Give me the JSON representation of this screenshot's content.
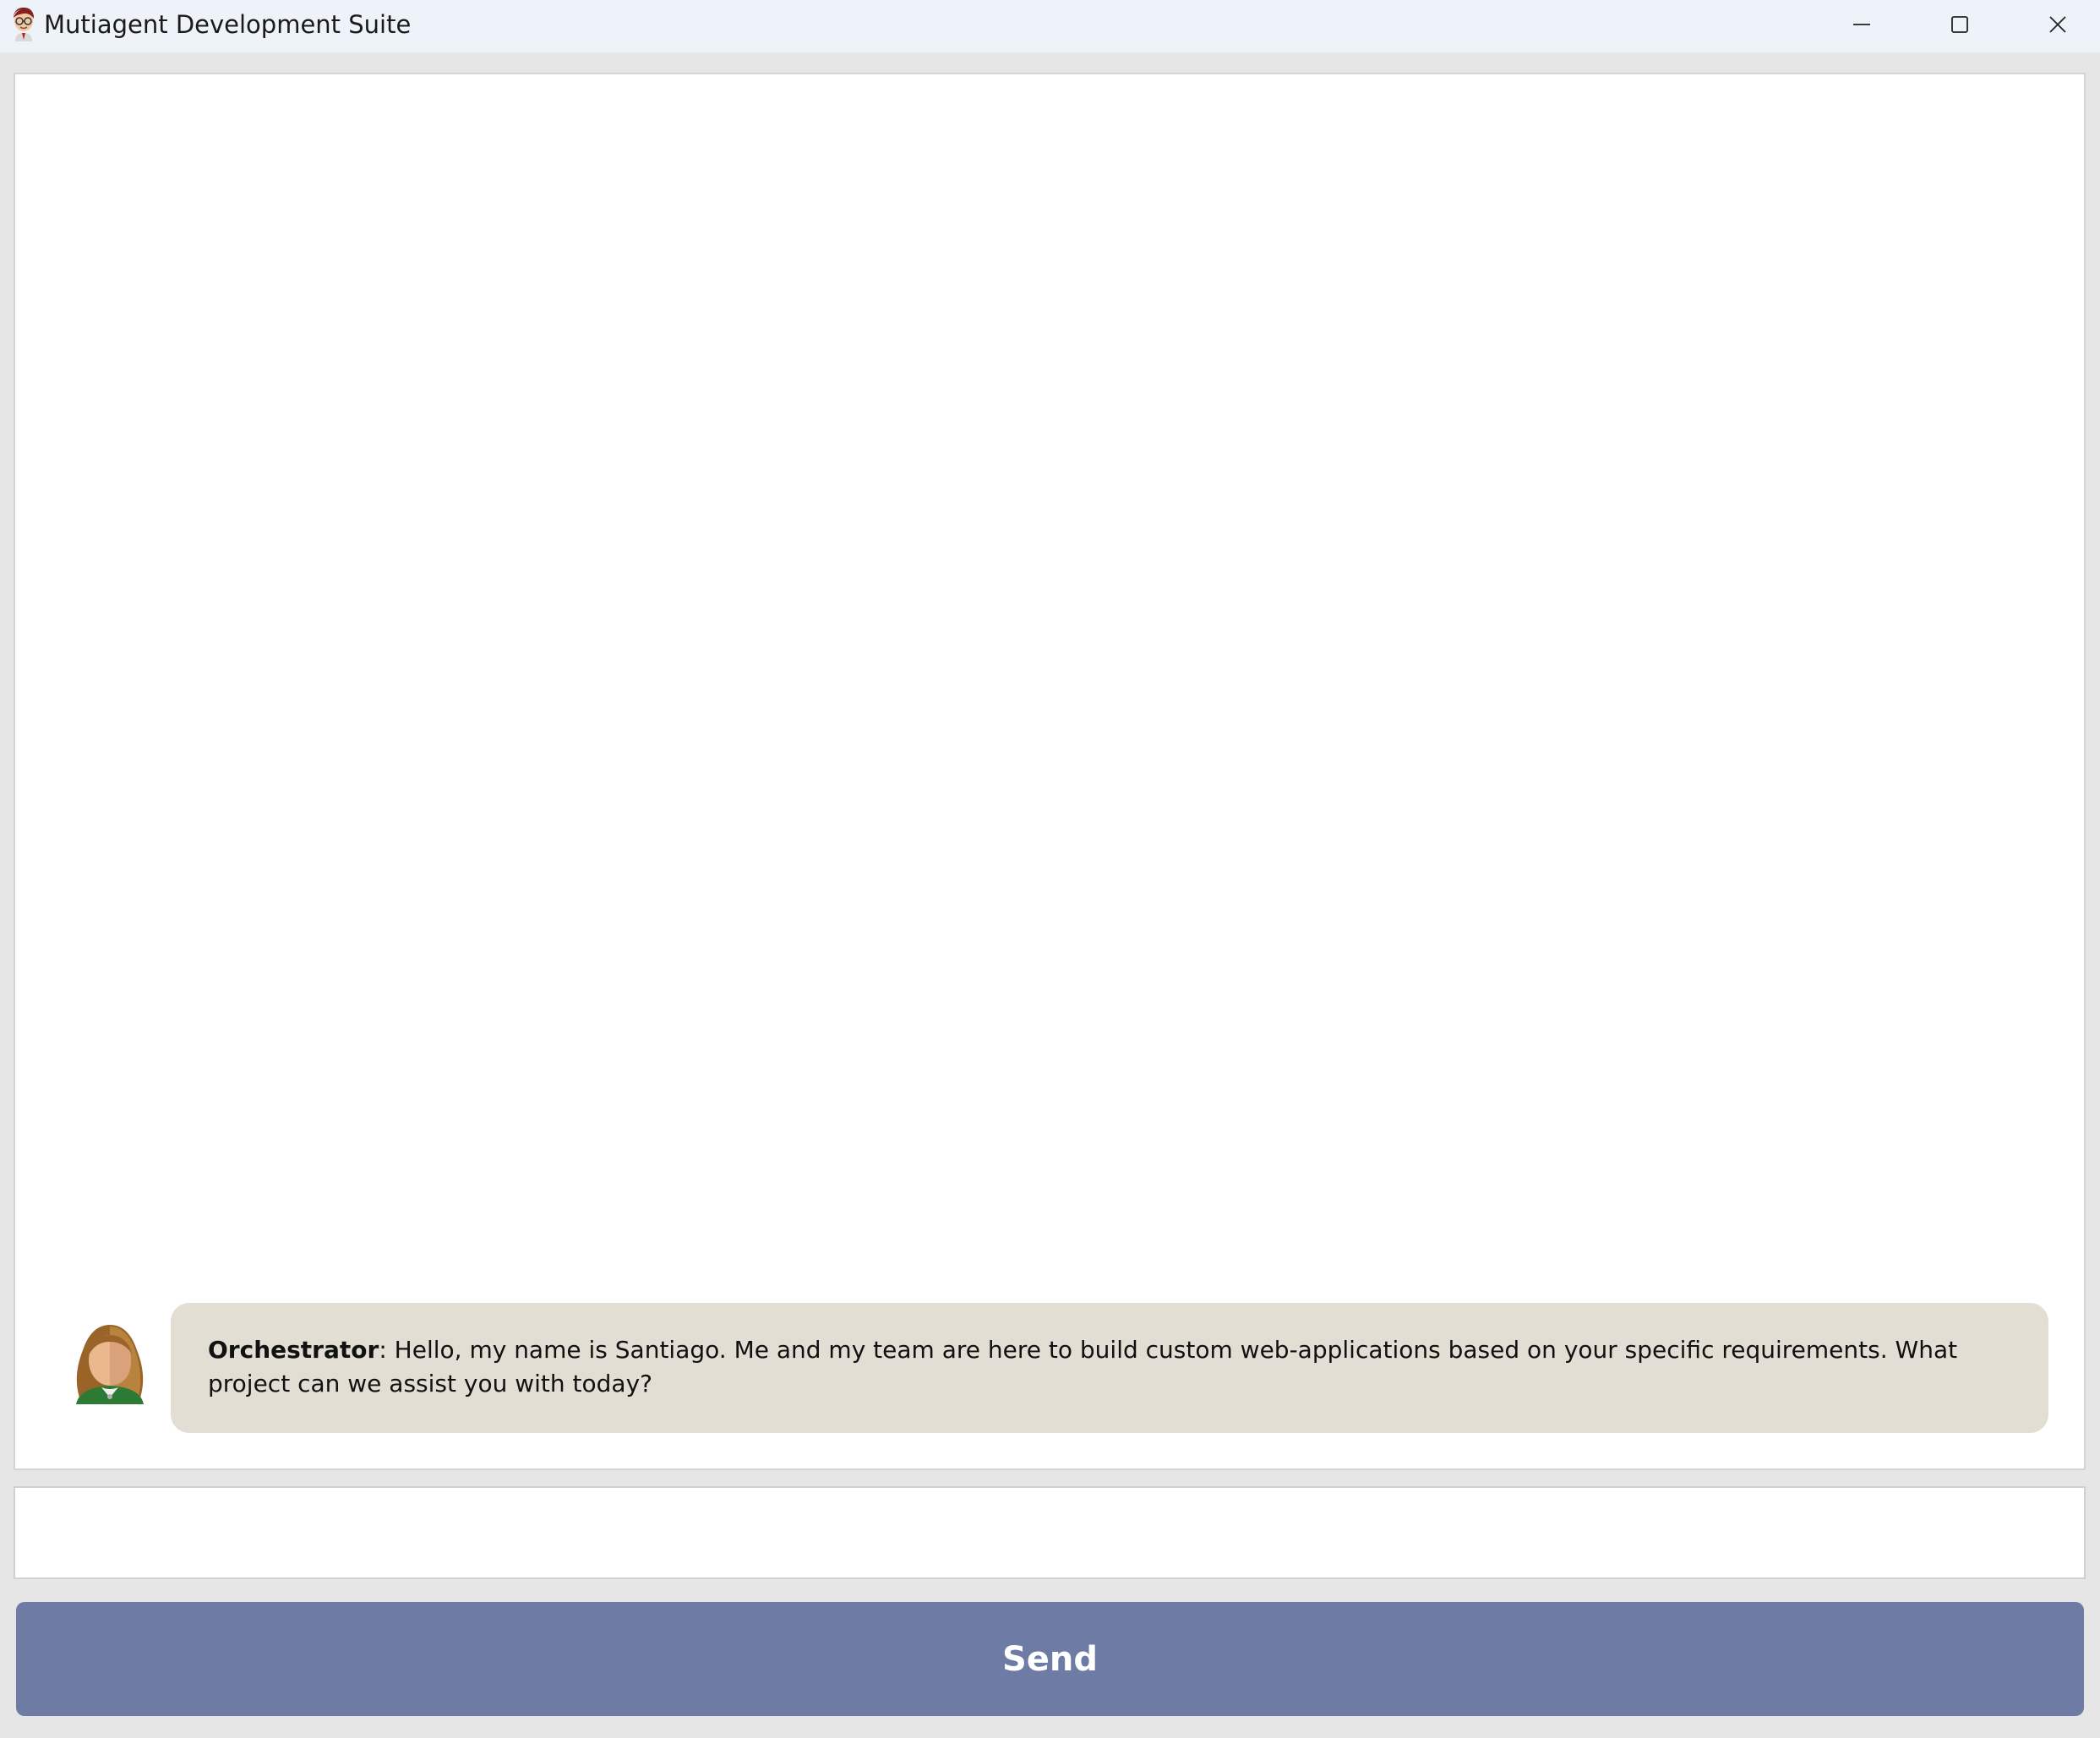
{
  "window": {
    "title": "Mutiagent Development Suite",
    "app_icon": "agent-face-icon",
    "controls": {
      "minimize_icon": "minimize-icon",
      "maximize_icon": "maximize-icon",
      "close_icon": "close-icon"
    }
  },
  "chat": {
    "messages": [
      {
        "sender": "Orchestrator",
        "separator": ": ",
        "text": "Hello, my name is Santiago. Me and my team are here to build custom web-applications based on your specific requirements. What project can we assist you with today?",
        "avatar": "female-avatar-icon"
      }
    ]
  },
  "input": {
    "value": "",
    "placeholder": ""
  },
  "send_button": {
    "label": "Send"
  },
  "colors": {
    "titlebar_bg": "#eef2f9",
    "window_bg": "#e6e6e6",
    "bubble_bg": "#e2ded3",
    "send_button_bg": "#6e7ba4",
    "send_button_text": "#ffffff"
  }
}
